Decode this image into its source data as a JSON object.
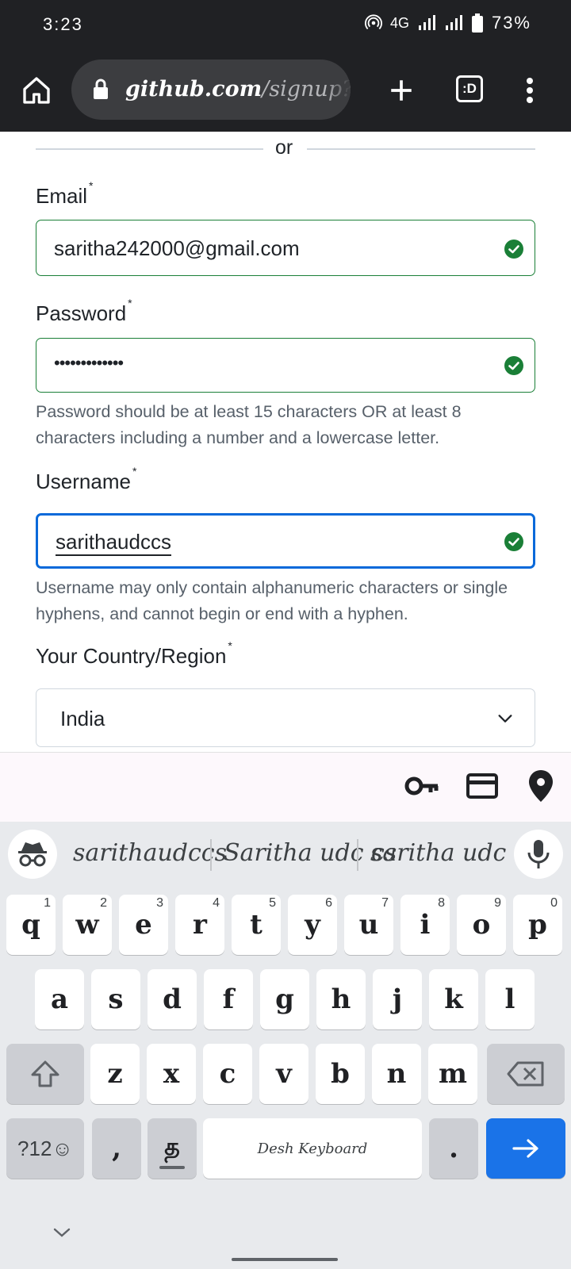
{
  "status_bar": {
    "time": "3:23",
    "network": "4G",
    "battery_pct": "73%"
  },
  "browser": {
    "url_host": "github.com",
    "url_path": "/signup?sour",
    "icons": [
      "home-icon",
      "lock-icon",
      "new-tab-icon",
      "tab-switcher-icon",
      "overflow-menu-icon"
    ],
    "tab_switcher_label": ":D"
  },
  "form": {
    "or_text": "or",
    "email": {
      "label": "Email",
      "required_mark": "*",
      "value": "saritha242000@gmail.com"
    },
    "password": {
      "label": "Password",
      "required_mark": "*",
      "value": "•••••••••••••",
      "hint": "Password should be at least 15 characters OR at least 8 characters including a number and a lowercase letter."
    },
    "username": {
      "label": "Username",
      "required_mark": "*",
      "value": "sarithaudccs",
      "hint": "Username may only contain alphanumeric characters or single hyphens, and cannot begin or end with a hyphen."
    },
    "country": {
      "label": "Your Country/Region",
      "required_mark": "*",
      "value": "India"
    },
    "colors": {
      "valid_border": "#1a7f37",
      "focus_border": "#0969da",
      "hint_text": "#57606a"
    }
  },
  "autofill_bar": {
    "icons": [
      "key-icon",
      "credit-card-icon",
      "location-pin-icon"
    ]
  },
  "keyboard": {
    "suggestions": [
      "sarithaudccs",
      "Saritha udc cs",
      "saritha udc cs"
    ],
    "row1": [
      {
        "k": "q",
        "n": "1"
      },
      {
        "k": "w",
        "n": "2"
      },
      {
        "k": "e",
        "n": "3"
      },
      {
        "k": "r",
        "n": "4"
      },
      {
        "k": "t",
        "n": "5"
      },
      {
        "k": "y",
        "n": "6"
      },
      {
        "k": "u",
        "n": "7"
      },
      {
        "k": "i",
        "n": "8"
      },
      {
        "k": "o",
        "n": "9"
      },
      {
        "k": "p",
        "n": "0"
      }
    ],
    "row2": [
      "a",
      "s",
      "d",
      "f",
      "g",
      "h",
      "j",
      "k",
      "l"
    ],
    "row3": [
      "z",
      "x",
      "c",
      "v",
      "b",
      "n",
      "m"
    ],
    "symbols_key": "?12☺",
    "comma_key": ",",
    "lang_key": "த",
    "space_label": "Desh Keyboard",
    "period_key": ".",
    "accent_color": "#1a73e8"
  }
}
